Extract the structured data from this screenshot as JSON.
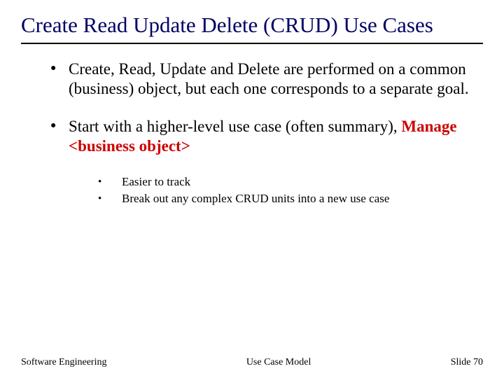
{
  "title": "Create Read Update Delete (CRUD) Use Cases",
  "bullets": [
    {
      "text": "Create, Read, Update and Delete are performed on a common (business) object, but each one corresponds to a separate goal."
    },
    {
      "prefix": "Start with a higher-level use case (often summary), ",
      "emph": "Manage <business object>",
      "sub": [
        "Easier to track",
        "Break out any complex CRUD units into a new use case"
      ]
    }
  ],
  "footer": {
    "left": "Software Engineering",
    "center": "Use Case Model",
    "right_prefix": "Slide ",
    "slide_number": "70"
  }
}
